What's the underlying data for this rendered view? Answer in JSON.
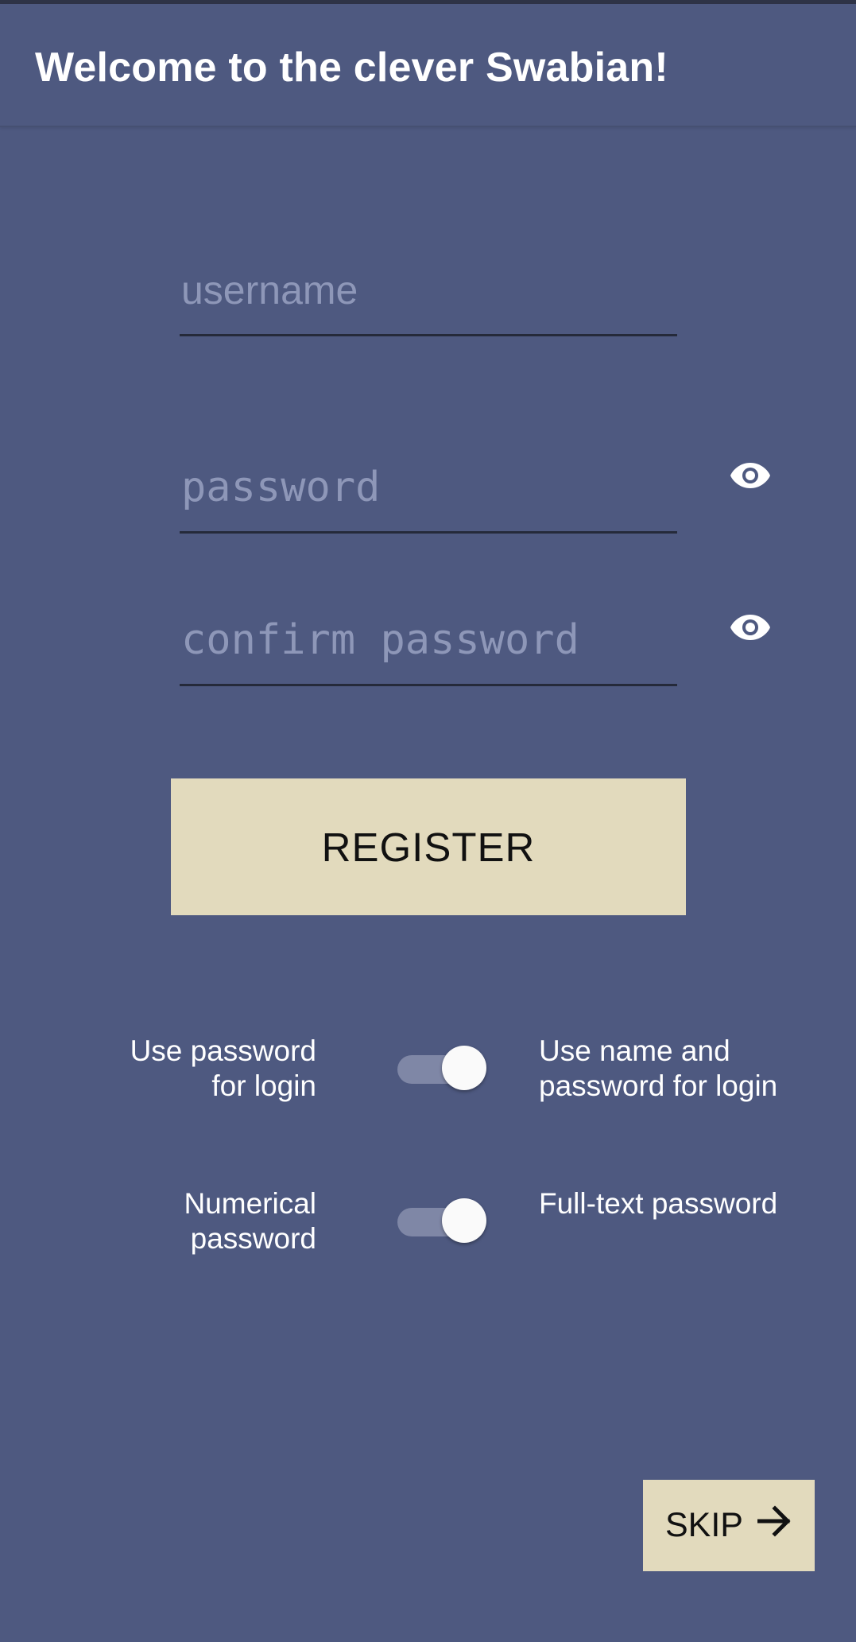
{
  "header": {
    "title": "Welcome to the clever Swabian!"
  },
  "form": {
    "username": {
      "value": "",
      "placeholder": "username"
    },
    "password": {
      "value": "",
      "placeholder": "password",
      "visibility_icon": "eye-icon"
    },
    "confirm_password": {
      "value": "",
      "placeholder": "confirm password",
      "visibility_icon": "eye-icon"
    },
    "register_label": "REGISTER"
  },
  "toggles": [
    {
      "left_label": "Use password for login",
      "right_label": "Use name and password for login",
      "state": "right"
    },
    {
      "left_label": "Numerical password",
      "right_label": "Full-text password",
      "state": "right"
    }
  ],
  "skip": {
    "label": "SKIP",
    "icon": "arrow-right-icon"
  },
  "colors": {
    "background": "#4e5980",
    "button": "#e2dabd",
    "placeholder": "#8e97b8",
    "toggle_track": "#7f87a6",
    "toggle_thumb": "#fafafa"
  }
}
